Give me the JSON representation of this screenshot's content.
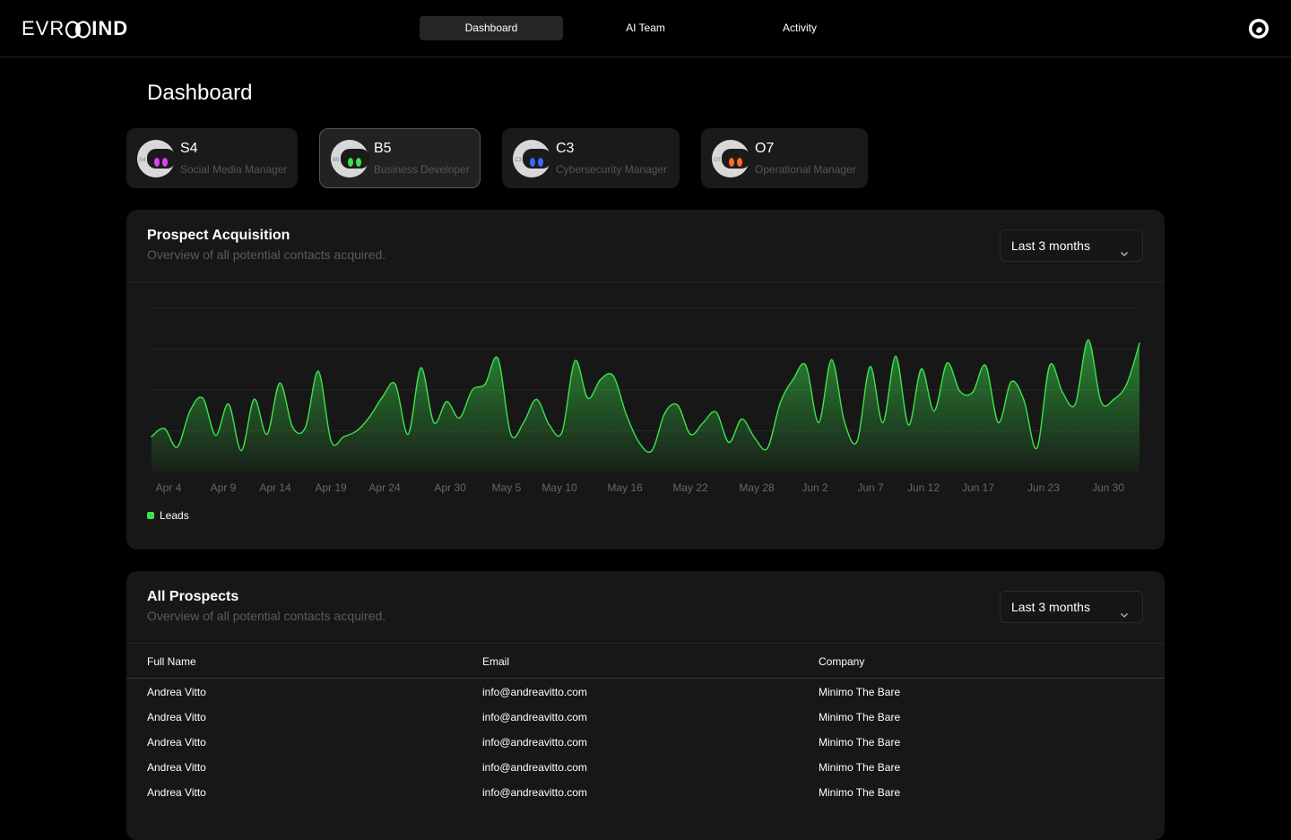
{
  "brand": {
    "logo_left": "EVR",
    "logo_right": "IND"
  },
  "nav": {
    "tabs": [
      {
        "label": "Dashboard"
      },
      {
        "label": "AI Team"
      },
      {
        "label": "Activity"
      }
    ]
  },
  "page": {
    "title": "Dashboard"
  },
  "agents": [
    {
      "code": "S4",
      "role": "Social Media Manager",
      "tiny": "S4",
      "eye_color": "#e040fb"
    },
    {
      "code": "B5",
      "role": "Business Developer",
      "tiny": "B5",
      "eye_color": "#3be34a"
    },
    {
      "code": "C3",
      "role": "Cybersecurity Manager",
      "tiny": "C3",
      "eye_color": "#3a6bff"
    },
    {
      "code": "O7",
      "role": "Operational Manager",
      "tiny": "O7",
      "eye_color": "#ff6a2a"
    }
  ],
  "prospect_card": {
    "title": "Prospect Acquisition",
    "subtitle": "Overview of all potential contacts acquired.",
    "range": "Last 3 months"
  },
  "chart_data": {
    "type": "area",
    "x_tick_labels": [
      "Apr 4",
      "Apr 9",
      "Apr 14",
      "Apr 19",
      "Apr 24",
      "Apr 30",
      "May 5",
      "May 10",
      "May 16",
      "May 22",
      "May 28",
      "Jun 2",
      "Jun 7",
      "Jun 12",
      "Jun 17",
      "Jun 23",
      "Jun 30"
    ],
    "series": [
      {
        "name": "Leads",
        "color": "#3be34a",
        "values": [
          30,
          37,
          21,
          52,
          63,
          31,
          58,
          18,
          62,
          32,
          76,
          38,
          38,
          86,
          26,
          30,
          35,
          47,
          64,
          75,
          32,
          89,
          42,
          60,
          46,
          70,
          75,
          97,
          32,
          42,
          62,
          40,
          34,
          95,
          63,
          79,
          82,
          49,
          25,
          18,
          50,
          57,
          32,
          42,
          51,
          25,
          45,
          29,
          20,
          59,
          79,
          91,
          42,
          96,
          43,
          26,
          90,
          42,
          99,
          40,
          88,
          52,
          93,
          69,
          68,
          91,
          42,
          77,
          61,
          20,
          91,
          68,
          58,
          113,
          60,
          62,
          75,
          110
        ]
      }
    ],
    "y_range_hint": [
      0,
      140
    ],
    "grid": true,
    "legend": "bottom-left"
  },
  "prospects_card": {
    "title": "All Prospects",
    "subtitle": "Overview of all potential contacts acquired.",
    "range": "Last 3 months",
    "columns": [
      "Full Name",
      "Email",
      "Company"
    ],
    "rows": [
      [
        "Andrea Vitto",
        "info@andreavitto.com",
        "Minimo The Bare"
      ],
      [
        "Andrea Vitto",
        "info@andreavitto.com",
        "Minimo The Bare"
      ],
      [
        "Andrea Vitto",
        "info@andreavitto.com",
        "Minimo The Bare"
      ],
      [
        "Andrea Vitto",
        "info@andreavitto.com",
        "Minimo The Bare"
      ],
      [
        "Andrea Vitto",
        "info@andreavitto.com",
        "Minimo The Bare"
      ]
    ]
  }
}
